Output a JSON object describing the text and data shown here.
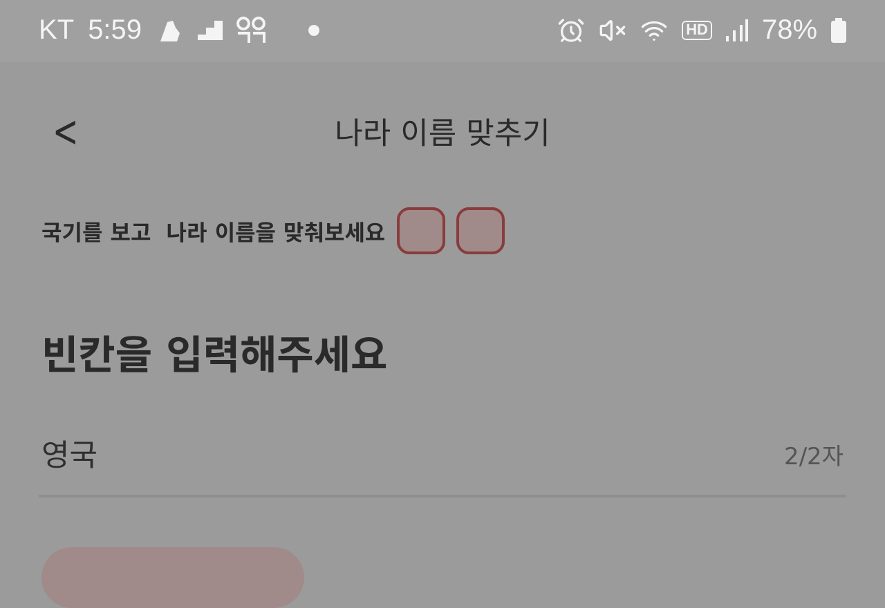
{
  "status_bar": {
    "carrier": "KT",
    "time": "5:59",
    "hd_label": "HD",
    "battery": "78%"
  },
  "header": {
    "back": "<",
    "title": "나라 이름 맞추기"
  },
  "quiz": {
    "instruction": "국기를 보고  나라 이름을 맞춰보세요",
    "blanks": [
      {
        "filled": false
      },
      {
        "filled": false
      }
    ]
  },
  "heading": "빈칸을 입력해주세요",
  "answer": {
    "value": "영국",
    "counter": "2/2자"
  }
}
